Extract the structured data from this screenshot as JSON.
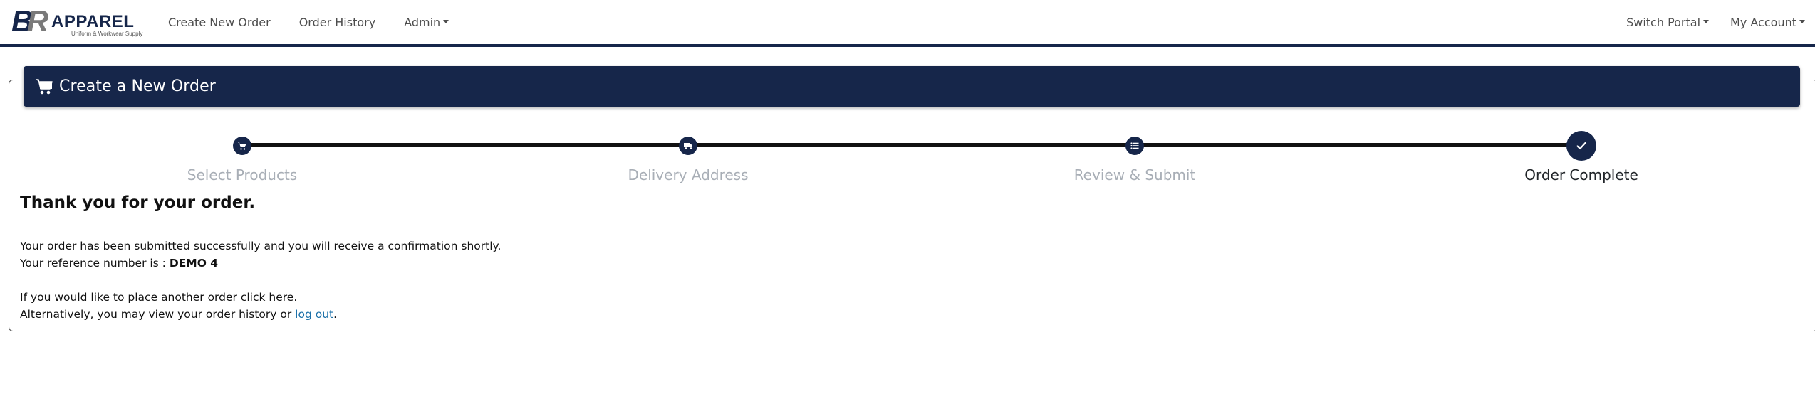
{
  "brand": {
    "name": "APPAREL",
    "tagline": "Uniform & Workwear Supply",
    "logo_letters": "BR",
    "primary_color": "#16264a",
    "secondary_color": "#7a7a7a"
  },
  "nav": {
    "left": [
      {
        "label": "Create New Order",
        "dropdown": false
      },
      {
        "label": "Order History",
        "dropdown": false
      },
      {
        "label": "Admin",
        "dropdown": true
      }
    ],
    "right": [
      {
        "label": "Switch Portal",
        "dropdown": true
      },
      {
        "label": "My Account",
        "dropdown": true
      }
    ]
  },
  "card": {
    "header_icon": "shopping-cart-icon",
    "title": "Create a New Order"
  },
  "stepper": {
    "steps": [
      {
        "label": "Select Products",
        "icon": "cart-icon",
        "active": false
      },
      {
        "label": "Delivery Address",
        "icon": "truck-icon",
        "active": false
      },
      {
        "label": "Review & Submit",
        "icon": "list-icon",
        "active": false
      },
      {
        "label": "Order Complete",
        "icon": "check-icon",
        "active": true
      }
    ]
  },
  "confirmation": {
    "heading": "Thank you for your order.",
    "submitted_text": "Your order has been submitted successfully and you will receive a confirmation shortly.",
    "reference_prefix": "Your reference number is : ",
    "reference_number": "DEMO 4",
    "another_order_prefix": "If you would like to place another order ",
    "another_order_link": "click here",
    "another_order_suffix": ".",
    "alt_prefix": "Alternatively, you may view your ",
    "order_history_link": "order history",
    "alt_middle": " or ",
    "logout_link": "log out",
    "alt_suffix": "."
  }
}
